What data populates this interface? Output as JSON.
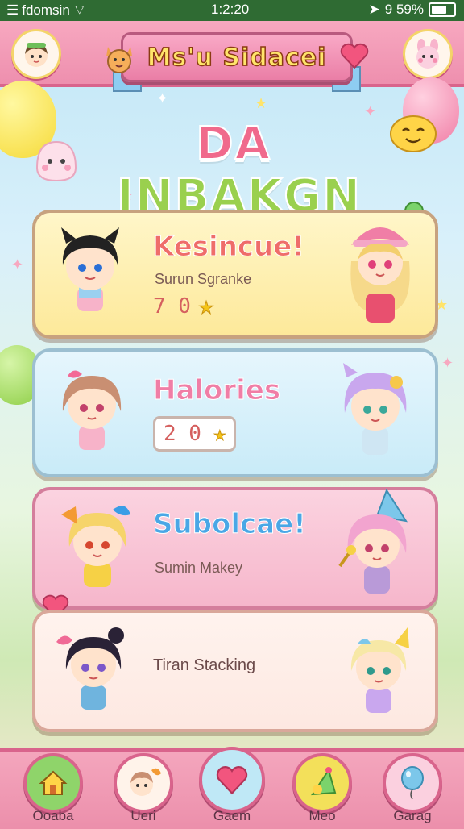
{
  "status_bar": {
    "app_name": "fdomsin",
    "time": "1:2:20",
    "battery": "9 59%"
  },
  "header": {
    "title": "Ms'u Sidacei"
  },
  "banner": {
    "title_part1": "DA",
    "title_part2": "INBAKGN"
  },
  "cards": [
    {
      "title": "Kesincue!",
      "subtitle": "Surun Sgranke",
      "score": "7 0"
    },
    {
      "title": "Halories",
      "score": "2 0"
    },
    {
      "title": "Subolcae!",
      "subtitle": "Sumin Makey"
    },
    {
      "subtitle": "Tiran Stacking"
    }
  ],
  "bottom_nav": [
    {
      "label": "Ooaba",
      "icon": "house-icon"
    },
    {
      "label": "Ueri",
      "icon": "character-icon"
    },
    {
      "label": "Gaem",
      "icon": "heart-icon"
    },
    {
      "label": "Meo",
      "icon": "party-hat-icon"
    },
    {
      "label": "Garag",
      "icon": "balloon-icon"
    }
  ],
  "colors": {
    "accent_pink": "#ee8fae",
    "status_bar": "#2f6b33",
    "star": "#f5c518"
  }
}
